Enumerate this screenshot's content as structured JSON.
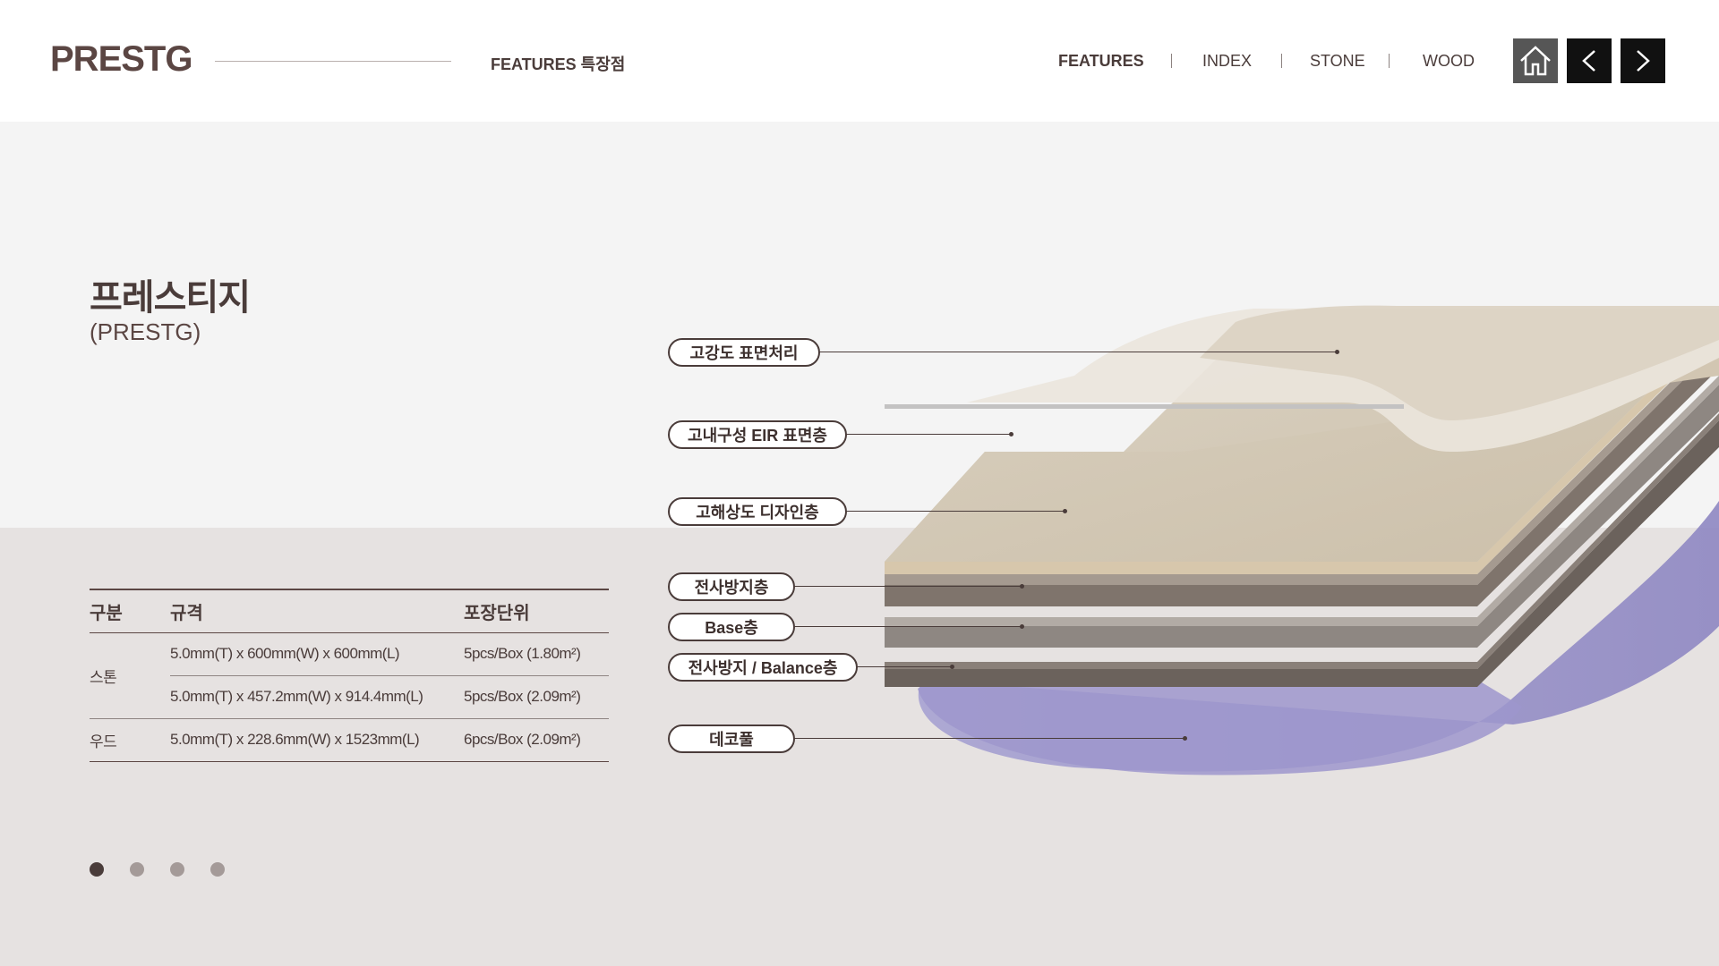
{
  "header": {
    "logo": "PRESTG",
    "breadcrumb": "FEATURES 특장점",
    "nav": [
      {
        "label": "FEATURES",
        "active": true
      },
      {
        "label": "INDEX",
        "active": false
      },
      {
        "label": "STONE",
        "active": false
      },
      {
        "label": "WOOD",
        "active": false
      }
    ],
    "buttons": {
      "home": "home-icon",
      "prev": "chevron-left-icon",
      "next": "chevron-right-icon"
    }
  },
  "product": {
    "title": "프레스티지",
    "subtitle": "(PRESTG)"
  },
  "spec_table": {
    "headers": [
      "구분",
      "규격",
      "포장단위"
    ],
    "groups": [
      {
        "category": "스톤",
        "rows": [
          {
            "size": "5.0mm(T) x 600mm(W) x 600mm(L)",
            "pack": "5pcs/Box (1.80m²)"
          },
          {
            "size": "5.0mm(T) x 457.2mm(W) x 914.4mm(L)",
            "pack": "5pcs/Box (2.09m²)"
          }
        ]
      },
      {
        "category": "우드",
        "rows": [
          {
            "size": "5.0mm(T) x 228.6mm(W) x 1523mm(L)",
            "pack": "6pcs/Box (2.09m²)"
          }
        ]
      }
    ]
  },
  "layers": [
    "고강도 표면처리",
    "고내구성 EIR 표면층",
    "고해상도 디자인층",
    "전사방지층",
    "Base층",
    "전사방지 / Balance층",
    "데코풀"
  ],
  "pagination": {
    "count": 4,
    "active": 0
  },
  "colors": {
    "brand": "#5b4643",
    "text": "#4a3c3a",
    "upper_band": "#f4f4f4",
    "lower_band": "#e6e2e1",
    "nav_button_dark": "#111111",
    "home_button": "#565656",
    "deco_glue": "#9e97cc"
  }
}
